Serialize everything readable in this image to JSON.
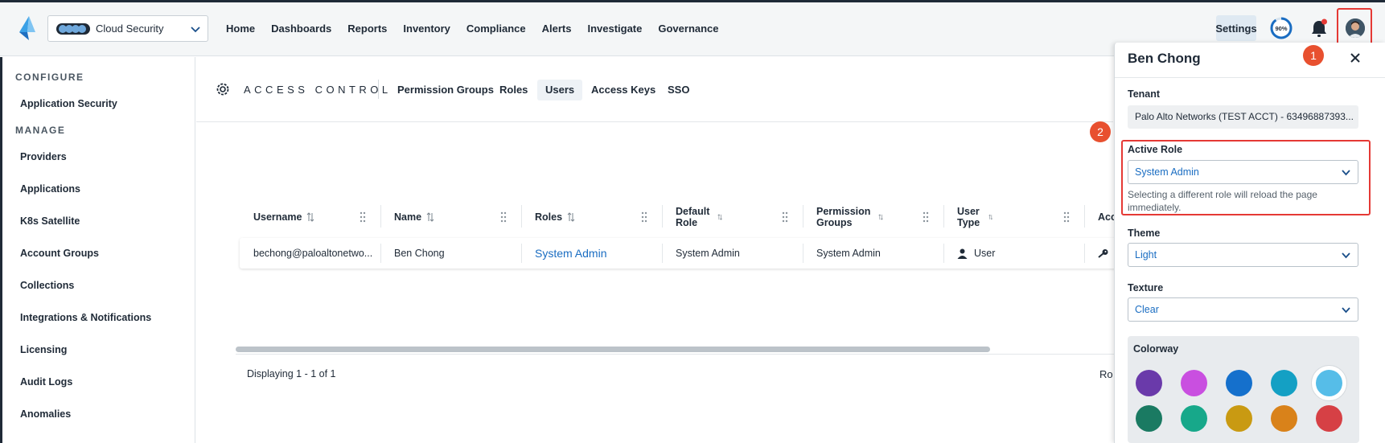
{
  "topbar": {
    "product": "Cloud Security",
    "nav": [
      "Home",
      "Dashboards",
      "Reports",
      "Inventory",
      "Compliance",
      "Alerts",
      "Investigate",
      "Governance"
    ],
    "settings": "Settings",
    "progress": "90%",
    "progress_value": 0.9
  },
  "sidebar": {
    "configure_label": "CONFIGURE",
    "configure_items": [
      "Application Security"
    ],
    "manage_label": "MANAGE",
    "manage_items": [
      "Providers",
      "Applications",
      "K8s Satellite",
      "Account Groups",
      "Collections",
      "Integrations & Notifications",
      "Licensing",
      "Audit Logs",
      "Anomalies"
    ]
  },
  "access_control": {
    "title": "ACCESS CONTROL",
    "tabs": [
      "Permission Groups",
      "Roles",
      "Users",
      "Access Keys",
      "SSO"
    ],
    "active_tab": "Users"
  },
  "table": {
    "columns": [
      "Username",
      "Name",
      "Roles",
      "Default Role",
      "Permission Groups",
      "User Type",
      "Acc"
    ],
    "rows": [
      {
        "username": "bechong@paloaltonetwo...",
        "name": "Ben Chong",
        "roles": "System Admin",
        "default_role": "System Admin",
        "permission_groups": "System Admin",
        "user_type": "User"
      }
    ],
    "footer": "Displaying 1 - 1 of 1",
    "footer_right": "Ro"
  },
  "panel": {
    "title": "Ben Chong",
    "tenant_label": "Tenant",
    "tenant_value": "Palo Alto Networks (TEST ACCT) - 63496887393...",
    "active_role_label": "Active Role",
    "active_role_value": "System Admin",
    "active_role_hint": "Selecting a different role will reload the page immediately.",
    "theme_label": "Theme",
    "theme_value": "Light",
    "texture_label": "Texture",
    "texture_value": "Clear",
    "colorway_label": "Colorway",
    "colorway_colors": [
      "#6a3aaa",
      "#c94fe0",
      "#1570cc",
      "#14a0c4",
      "#56bde8",
      "#1a7a62",
      "#17a88a",
      "#c99a12",
      "#d9821a",
      "#d64045"
    ],
    "selected_colorway": 4
  },
  "annotations": [
    "1",
    "2"
  ],
  "colors": {
    "accent": "#1a6dc2",
    "annotation": "#e53935"
  }
}
